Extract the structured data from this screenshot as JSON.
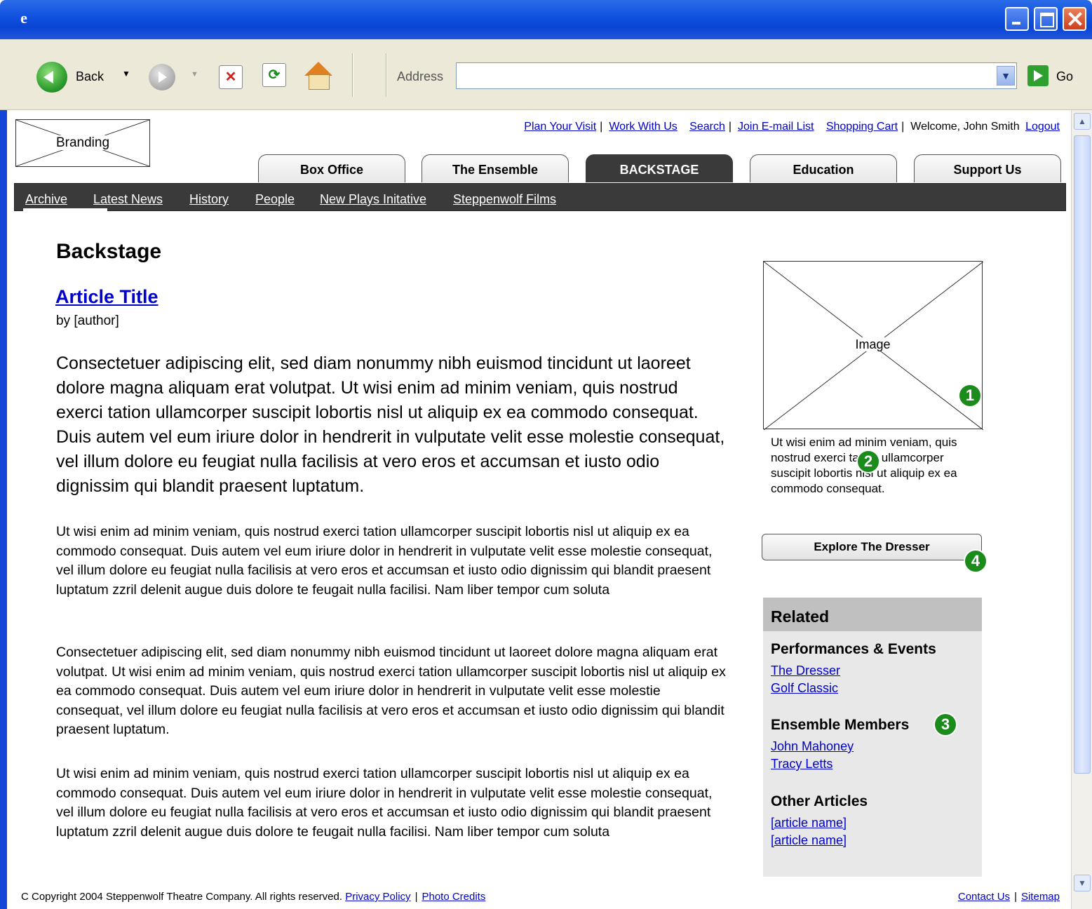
{
  "browser": {
    "toolbar": {
      "back_label": "Back",
      "address_label": "Address",
      "address_value": "",
      "go_label": "Go"
    }
  },
  "header": {
    "branding": "Branding",
    "utility_links": [
      "Plan Your Visit",
      "Work With Us",
      "Search",
      "Join E-mail List",
      "Shopping Cart"
    ],
    "welcome": "Welcome, John Smith",
    "logout": "Logout"
  },
  "tabs": [
    "Box Office",
    "The Ensemble",
    "BACKSTAGE",
    "Education",
    "Support Us"
  ],
  "subnav": [
    "Archive",
    "Latest News",
    "History",
    "People",
    "New Plays Initative",
    "Steppenwolf Films"
  ],
  "main": {
    "page_title": "Backstage",
    "article_title": "Article Title",
    "author": "by [author]",
    "lede": "Consectetuer adipiscing elit, sed diam nonummy nibh euismod tincidunt ut laoreet dolore magna aliquam erat volutpat. Ut wisi enim ad minim veniam, quis nostrud exerci tation ullamcorper suscipit lobortis nisl ut aliquip ex ea commodo consequat. Duis autem vel eum iriure dolor in hendrerit in vulputate velit esse molestie consequat, vel illum dolore eu feugiat nulla facilisis at vero eros et accumsan et iusto odio dignissim qui blandit praesent luptatum.",
    "paragraphs": [
      "Ut wisi enim ad minim veniam, quis nostrud exerci tation ullamcorper suscipit lobortis nisl ut aliquip ex ea commodo consequat. Duis autem vel eum iriure dolor in hendrerit in vulputate velit esse molestie consequat, vel illum dolore eu feugiat nulla facilisis at vero eros et accumsan et iusto odio dignissim qui blandit praesent luptatum zzril delenit augue duis dolore te feugait nulla facilisi. Nam liber tempor cum soluta",
      "Consectetuer adipiscing elit, sed diam nonummy nibh euismod tincidunt ut laoreet dolore magna aliquam erat volutpat. Ut wisi enim ad minim veniam, quis nostrud exerci tation ullamcorper suscipit lobortis nisl ut aliquip ex ea commodo consequat. Duis autem vel eum iriure dolor in hendrerit in vulputate velit esse molestie consequat, vel illum dolore eu feugiat nulla facilisis at vero eros et accumsan et iusto odio dignissim qui blandit praesent luptatum.",
      "Ut wisi enim ad minim veniam, quis nostrud exerci tation ullamcorper suscipit lobortis nisl ut aliquip ex ea commodo consequat. Duis autem vel eum iriure dolor in hendrerit in vulputate velit esse molestie consequat, vel illum dolore eu feugiat nulla facilisis at vero eros et accumsan et iusto odio dignissim qui blandit praesent luptatum zzril delenit augue duis dolore te feugait nulla facilisi. Nam liber tempor cum soluta"
    ]
  },
  "sidebar": {
    "image_label": "Image",
    "caption": "Ut wisi enim ad minim veniam, quis nostrud exerci tation ullamcorper suscipit lobortis nisl ut aliquip ex ea commodo consequat.",
    "explore_button": "Explore The Dresser",
    "related": {
      "title": "Related",
      "sections": [
        {
          "heading": "Performances & Events",
          "links": [
            "The Dresser",
            "Golf Classic"
          ]
        },
        {
          "heading": "Ensemble Members",
          "links": [
            "John Mahoney",
            "Tracy Letts"
          ]
        },
        {
          "heading": "Other Articles",
          "links": [
            "[article name]",
            "[article name]"
          ]
        }
      ]
    }
  },
  "badges": [
    "1",
    "2",
    "3",
    "4"
  ],
  "footer": {
    "copyright": "C Copyright 2004 Steppenwolf Theatre Company. All rights reserved.",
    "privacy": "Privacy Policy",
    "photo_credits": "Photo Credits",
    "contact": "Contact Us",
    "sitemap": "Sitemap"
  },
  "colors": {
    "nav_dark": "#3a3a3a",
    "link": "#0000cc",
    "badge": "#1b8b1b",
    "related_bg": "#e8e8e8",
    "related_header": "#c0c0c0"
  }
}
